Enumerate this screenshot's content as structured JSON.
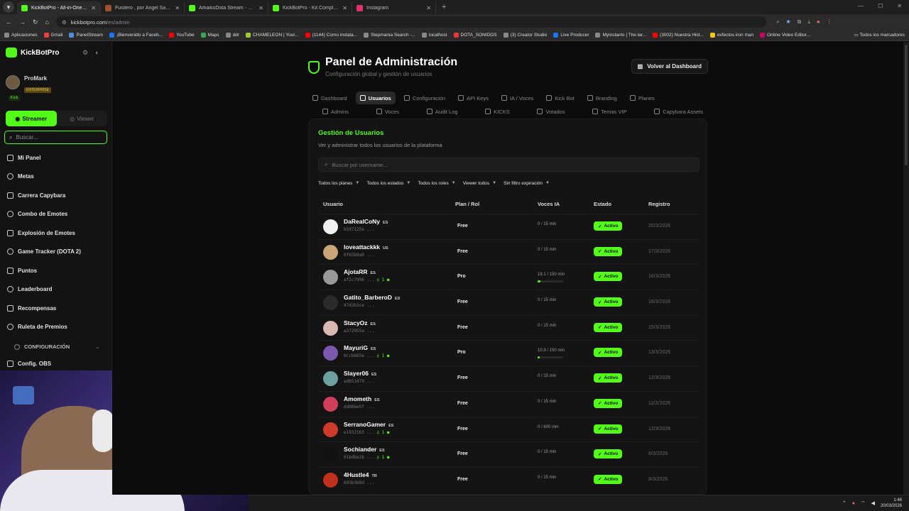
{
  "browser": {
    "tabs": [
      {
        "title": "KickBotPro - All-in-One Stream",
        "active": true,
        "color": "#53fc18"
      },
      {
        "title": "Fusilero , por Ángel Sacristán",
        "active": false,
        "color": "#a0522d"
      },
      {
        "title": "ArkaikoDota Stream - Watch Li",
        "active": false,
        "color": "#53fc18"
      },
      {
        "title": "KickBotPro - Kit Completo de S",
        "active": false,
        "color": "#53fc18"
      },
      {
        "title": "Instagram",
        "active": false,
        "color": "#e1306c"
      }
    ],
    "url": "kickbotpro.com",
    "url_path": "/es/admin",
    "bookmarks": [
      {
        "label": "Aplicaciones",
        "color": "#888888"
      },
      {
        "label": "Gmail",
        "color": "#ea4335"
      },
      {
        "label": "PanelStream",
        "color": "#4a90e2"
      },
      {
        "label": "¡Bienvenido a Faceb...",
        "color": "#1877f2"
      },
      {
        "label": "YouTube",
        "color": "#ff0000"
      },
      {
        "label": "Maps",
        "color": "#34a853"
      },
      {
        "label": "ddr",
        "color": "#888888"
      },
      {
        "label": "CHAMELEON | Your...",
        "color": "#9acd32"
      },
      {
        "label": "(1144) Como instala...",
        "color": "#ff0000"
      },
      {
        "label": "Stepmania Search -...",
        "color": "#888888"
      },
      {
        "label": "localhost",
        "color": "#888888"
      },
      {
        "label": "DOTA_SONIDOS",
        "color": "#e33"
      },
      {
        "label": "(3) Creator Studio",
        "color": "#888888"
      },
      {
        "label": "Live Producer",
        "color": "#1877f2"
      },
      {
        "label": "Myinstants | The lar...",
        "color": "#888888"
      },
      {
        "label": "(3002) Nuestra Hist...",
        "color": "#ff0000"
      },
      {
        "label": "evfectos iron man",
        "color": "#f5c518"
      },
      {
        "label": "Online Video Editor...",
        "color": "#c06"
      }
    ],
    "bookmarks_all": "Todos los marcadores"
  },
  "sidebar": {
    "brand": "KickBotPro",
    "user_name": "ProMark",
    "user_tier": "ENTERPRISE",
    "platform": "Kick",
    "mode_streamer": "Streamer",
    "mode_viewer": "Viewer",
    "search_placeholder": "Buscar...",
    "items": [
      {
        "label": "Mi Panel"
      },
      {
        "label": "Metas"
      },
      {
        "label": "Carrera Capybara"
      },
      {
        "label": "Combo de Emotes"
      },
      {
        "label": "Explosión de Emotes"
      },
      {
        "label": "Game Tracker (DOTA 2)"
      },
      {
        "label": "Puntos"
      },
      {
        "label": "Leaderboard"
      },
      {
        "label": "Recompensas"
      },
      {
        "label": "Ruleta de Premios"
      }
    ],
    "section_config": "CONFIGURACIÓN",
    "config_obs": "Config. OBS"
  },
  "header": {
    "title": "Panel de Administración",
    "subtitle": "Configuración global y gestión de usuarios",
    "back_button": "Volver al Dashboard"
  },
  "tabs_row1": [
    {
      "label": "Dashboard",
      "active": false
    },
    {
      "label": "Usuarios",
      "active": true
    },
    {
      "label": "Configuración",
      "active": false
    },
    {
      "label": "API Keys",
      "active": false
    },
    {
      "label": "IA / Voces",
      "active": false
    },
    {
      "label": "Kick Bot",
      "active": false
    },
    {
      "label": "Branding",
      "active": false
    },
    {
      "label": "Planes",
      "active": false
    }
  ],
  "tabs_row2": [
    {
      "label": "Admins"
    },
    {
      "label": "Voces"
    },
    {
      "label": "Audit Log"
    },
    {
      "label": "KICKS"
    },
    {
      "label": "Votados"
    },
    {
      "label": "Temas VIP"
    },
    {
      "label": "Capybara Assets"
    }
  ],
  "users_panel": {
    "title": "Gestión de Usuarios",
    "subtitle": "Ver y administrar todos los usuarios de la plataforma",
    "search_placeholder": "Buscar por username...",
    "filters": [
      "Todos los planes",
      "Todos los estados",
      "Todos los roles",
      "Viewer todos",
      "Sin filtro expiración"
    ],
    "columns": {
      "user": "Usuario",
      "plan": "Plan / Rol",
      "voices": "Voces IA",
      "status": "Estado",
      "registered": "Registro"
    },
    "rows": [
      {
        "name": "DaRealCoNy",
        "cc": "ES",
        "id": "b597125e ...",
        "votes": "",
        "plan": "Free",
        "voices": "0 / 15 min",
        "used_fraction": 0,
        "status": "Activo",
        "date": "20/3/2026",
        "avatar": "#f0f0f0"
      },
      {
        "name": "loveattackkk",
        "cc": "US",
        "id": "0f65b9a0 ...",
        "votes": "",
        "plan": "Free",
        "voices": "0 / 15 min",
        "used_fraction": 0,
        "status": "Activo",
        "date": "17/3/2026",
        "avatar": "#c9a57a"
      },
      {
        "name": "AjotaRR",
        "cc": "ES",
        "id": "af2c7996 ...",
        "votes": "1",
        "plan": "Pro",
        "voices": "18.1 / 150 min",
        "used_fraction": 0.12,
        "status": "Activo",
        "date": "16/3/2026",
        "avatar": "#999999"
      },
      {
        "name": "Gatito_BarberoD",
        "cc": "ES",
        "id": "47d3b3ce ...",
        "votes": "",
        "plan": "Free",
        "voices": "0 / 15 min",
        "used_fraction": 0,
        "status": "Activo",
        "date": "16/3/2026",
        "avatar": "#2a2a2a"
      },
      {
        "name": "StacyOz",
        "cc": "ES",
        "id": "a372955a ...",
        "votes": "",
        "plan": "Free",
        "voices": "0 / 15 min",
        "used_fraction": 0,
        "status": "Activo",
        "date": "15/3/2026",
        "avatar": "#d8b8b0"
      },
      {
        "name": "MayuriG",
        "cc": "ES",
        "id": "0ccb665e ...",
        "votes": "1",
        "plan": "Pro",
        "voices": "10.9 / 150 min",
        "used_fraction": 0.07,
        "status": "Activo",
        "date": "13/3/2026",
        "avatar": "#7a5ab0"
      },
      {
        "name": "Slayer06",
        "cc": "ES",
        "id": "adb51d79 ...",
        "votes": "",
        "plan": "Free",
        "voices": "0 / 15 min",
        "used_fraction": 0,
        "status": "Activo",
        "date": "12/3/2026",
        "avatar": "#6aa0a0"
      },
      {
        "name": "Amometh",
        "cc": "ES",
        "id": "dd086e5f ...",
        "votes": "",
        "plan": "Free",
        "voices": "0 / 15 min",
        "used_fraction": 0,
        "status": "Activo",
        "date": "12/3/2026",
        "avatar": "#d0405a"
      },
      {
        "name": "SerranoGamer",
        "cc": "ES",
        "id": "e1932163 ...",
        "votes": "1",
        "plan": "Free",
        "voices": "0 / 600 min",
        "used_fraction": 0,
        "status": "Activo",
        "date": "12/3/2026",
        "avatar": "#d03a2a"
      },
      {
        "name": "Sochiander",
        "cc": "ES",
        "id": "01bdba1b ...",
        "votes": "1",
        "plan": "Free",
        "voices": "0 / 15 min",
        "used_fraction": 0,
        "status": "Activo",
        "date": "8/3/2026",
        "avatar": "#111111"
      },
      {
        "name": "4Hustle4",
        "cc": "TR",
        "id": "693b369d ...",
        "votes": "",
        "plan": "Free",
        "voices": "0 / 15 min",
        "used_fraction": 0,
        "status": "Activo",
        "date": "8/3/2026",
        "avatar": "#c0301a"
      }
    ]
  },
  "taskbar": {
    "time": "1:46",
    "date": "20/03/2026"
  },
  "colors": {
    "accent": "#53fc18",
    "background": "#0c0c0c",
    "card": "#141414"
  }
}
